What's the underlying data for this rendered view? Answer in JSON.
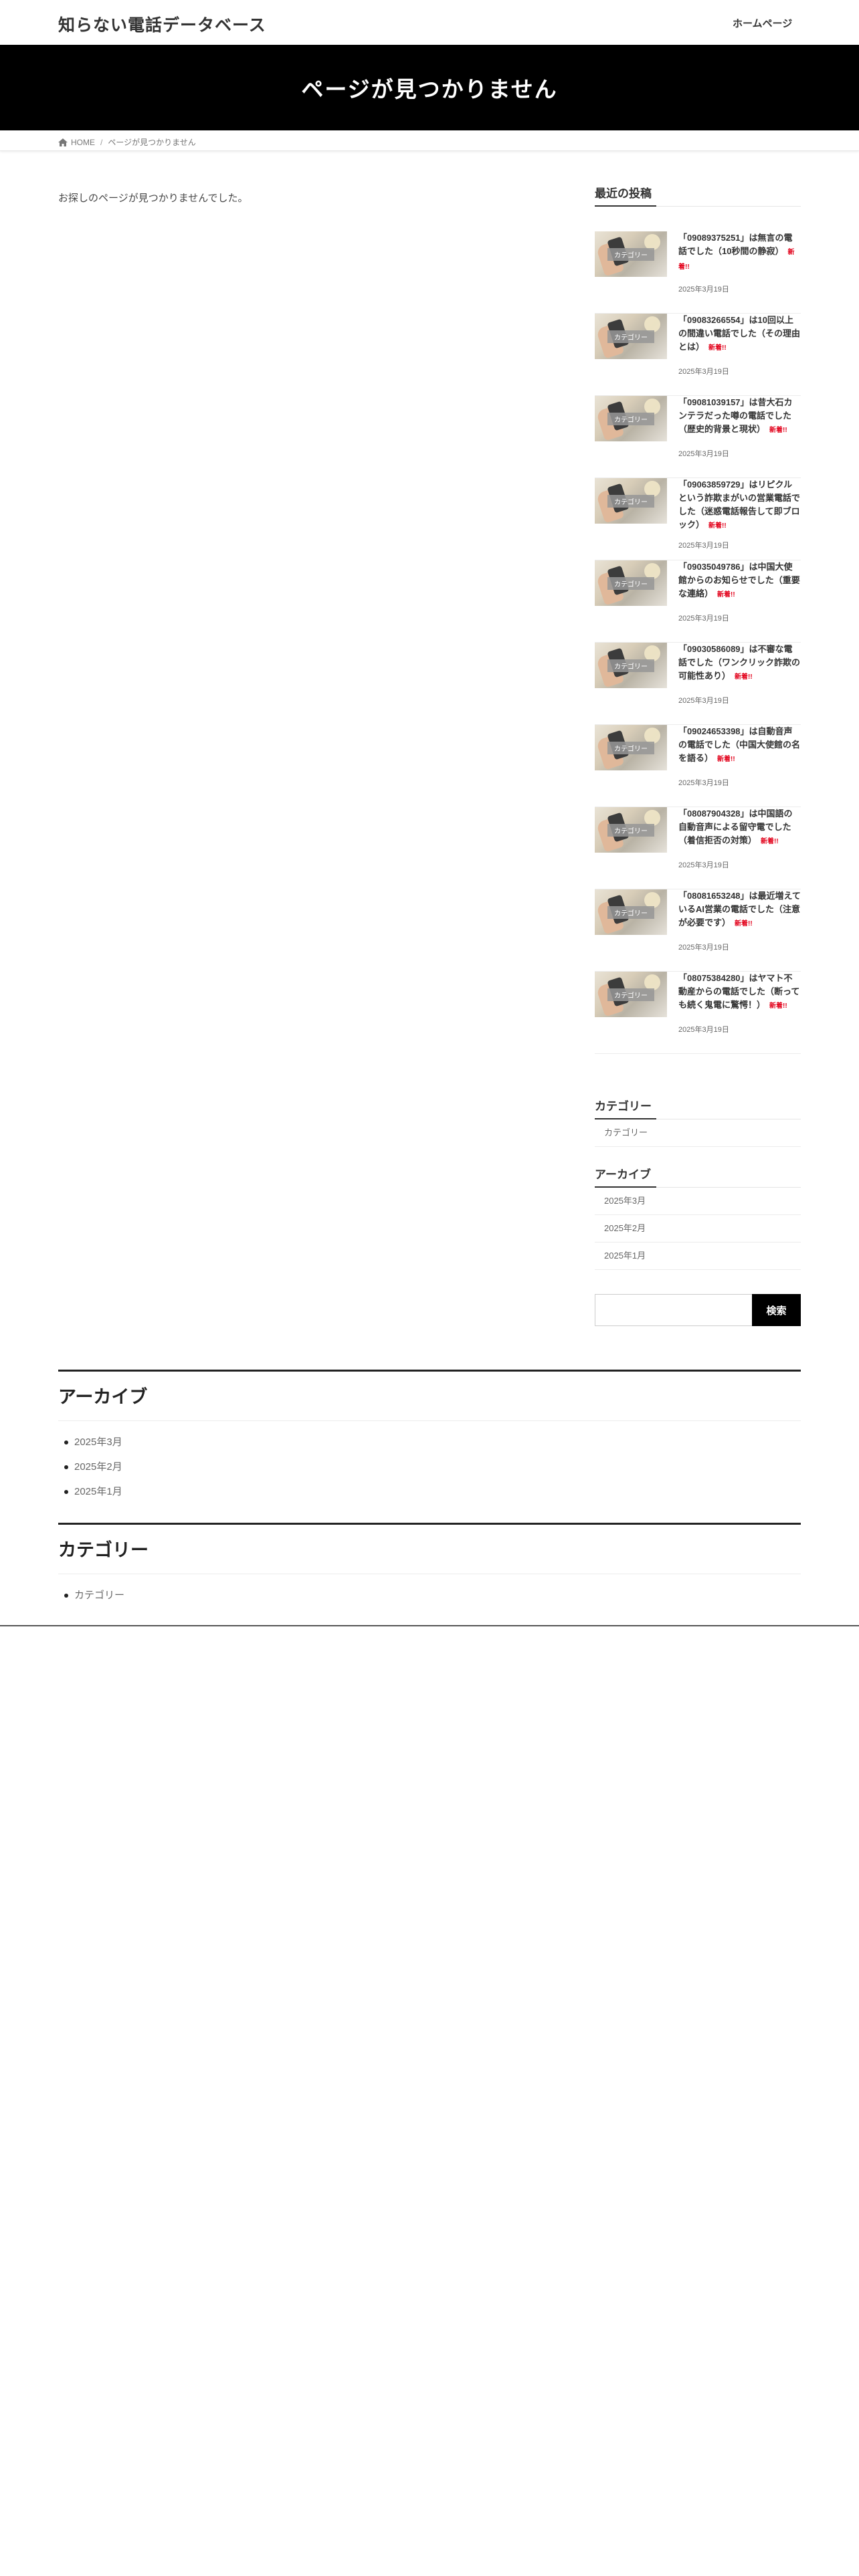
{
  "header": {
    "site_title": "知らない電話データベース",
    "nav": [
      "ホームページ"
    ]
  },
  "page_header": {
    "title": "ページが見つかりません"
  },
  "breadcrumb": {
    "home": "HOME",
    "separator": "/",
    "current": "ページが見つかりません"
  },
  "main": {
    "message": "お探しのページが見つかりませんでした。"
  },
  "sidebar": {
    "recent_posts": {
      "title": "最近の投稿",
      "category_label": "カテゴリー",
      "new_badge": "新着!!",
      "items": [
        {
          "title": "「09089375251」は無言の電話でした（10秒間の静寂）",
          "date": "2025年3月19日"
        },
        {
          "title": "「09083266554」は10回以上の間違い電話でした（その理由とは）",
          "date": "2025年3月19日"
        },
        {
          "title": "「09081039157」は昔大石カンテラだった噂の電話でした（歴史的背景と現状）",
          "date": "2025年3月19日"
        },
        {
          "title": "「09063859729」はリピクルという詐欺まがいの営業電話でした（迷惑電話報告して即ブロック）",
          "date": "2025年3月19日"
        },
        {
          "title": "「09035049786」は中国大使館からのお知らせでした（重要な連絡）",
          "date": "2025年3月19日"
        },
        {
          "title": "「09030586089」は不審な電話でした（ワンクリック詐欺の可能性あり）",
          "date": "2025年3月19日"
        },
        {
          "title": "「09024653398」は自動音声の電話でした（中国大使館の名を語る）",
          "date": "2025年3月19日"
        },
        {
          "title": "「08087904328」は中国語の自動音声による留守電でした（着信拒否の対策）",
          "date": "2025年3月19日"
        },
        {
          "title": "「08081653248」は最近増えているAI営業の電話でした（注意が必要です）",
          "date": "2025年3月19日"
        },
        {
          "title": "「08075384280」はヤマト不動産からの電話でした（断っても続く鬼電に驚愕！）",
          "date": "2025年3月19日"
        }
      ]
    },
    "categories": {
      "title": "カテゴリー",
      "items": [
        "カテゴリー"
      ]
    },
    "archives": {
      "title": "アーカイブ",
      "items": [
        "2025年3月",
        "2025年2月",
        "2025年1月"
      ]
    },
    "search": {
      "placeholder": "",
      "button_label": "検索"
    }
  },
  "footer": {
    "archives": {
      "title": "アーカイブ",
      "items": [
        "2025年3月",
        "2025年2月",
        "2025年1月"
      ]
    },
    "categories": {
      "title": "カテゴリー",
      "items": [
        "カテゴリー"
      ]
    }
  },
  "colors": {
    "hero_bg": "#000000",
    "new_badge": "#e2001a",
    "search_button": "#000000"
  }
}
